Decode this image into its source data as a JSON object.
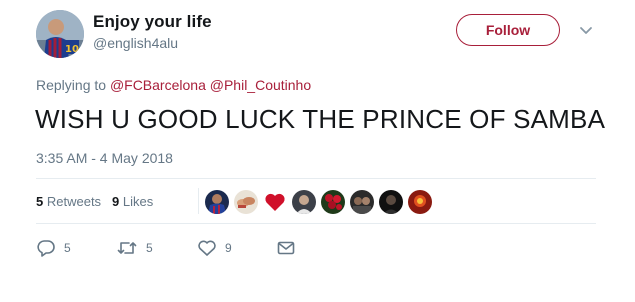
{
  "user": {
    "display_name": "Enjoy your life",
    "handle": "@english4alu",
    "avatar_icon": "profile-photo-football-player"
  },
  "follow_label": "Follow",
  "menu_icon": "chevron-down-icon",
  "reply": {
    "prefix": "Replying to ",
    "mentions": [
      "@FCBarcelona",
      "@Phil_Coutinho"
    ]
  },
  "text": "WISH U GOOD LUCK THE PRINCE OF SAMBA",
  "timestamp": "3:35 AM - 4 May 2018",
  "stats": {
    "retweets_count": "5",
    "retweets_label": "Retweets",
    "likes_count": "9",
    "likes_label": "Likes"
  },
  "likers": [
    "liker-avatar-player",
    "liker-avatar-hands",
    "liker-avatar-heart",
    "liker-avatar-portrait",
    "liker-avatar-roses",
    "liker-avatar-group",
    "liker-avatar-dark",
    "liker-avatar-red"
  ],
  "actions": {
    "reply_count": "5",
    "retweet_count": "5",
    "like_count": "9"
  },
  "colors": {
    "accent": "#a81f3a",
    "muted": "#657786",
    "text": "#14171a",
    "divider": "#e6ecf0"
  }
}
